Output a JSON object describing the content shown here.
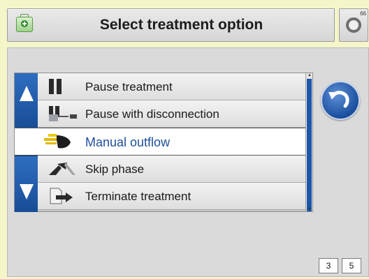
{
  "header": {
    "title": "Select treatment option",
    "corner_number": "66",
    "icon": "medical-kit-icon",
    "settings_icon": "settings-ring-icon"
  },
  "list": {
    "items": [
      {
        "label": "Pause treatment",
        "icon": "pause-icon",
        "selected": false
      },
      {
        "label": "Pause with disconnection",
        "icon": "pause-disconnect-icon",
        "selected": false
      },
      {
        "label": "Manual outflow",
        "icon": "hand-outflow-icon",
        "selected": true
      },
      {
        "label": "Skip phase",
        "icon": "skip-phase-icon",
        "selected": false
      },
      {
        "label": "Terminate treatment",
        "icon": "terminate-icon",
        "selected": false
      }
    ]
  },
  "scroll": {
    "up_icon": "triangle-up-icon",
    "down_icon": "triangle-down-icon"
  },
  "back_button": {
    "icon": "undo-arrow-icon"
  },
  "pagination": {
    "current": "3",
    "total": "5"
  },
  "colors": {
    "accent_blue": "#1c57a8",
    "background": "#f4f6c9",
    "selected_text": "#1f4f9c"
  }
}
